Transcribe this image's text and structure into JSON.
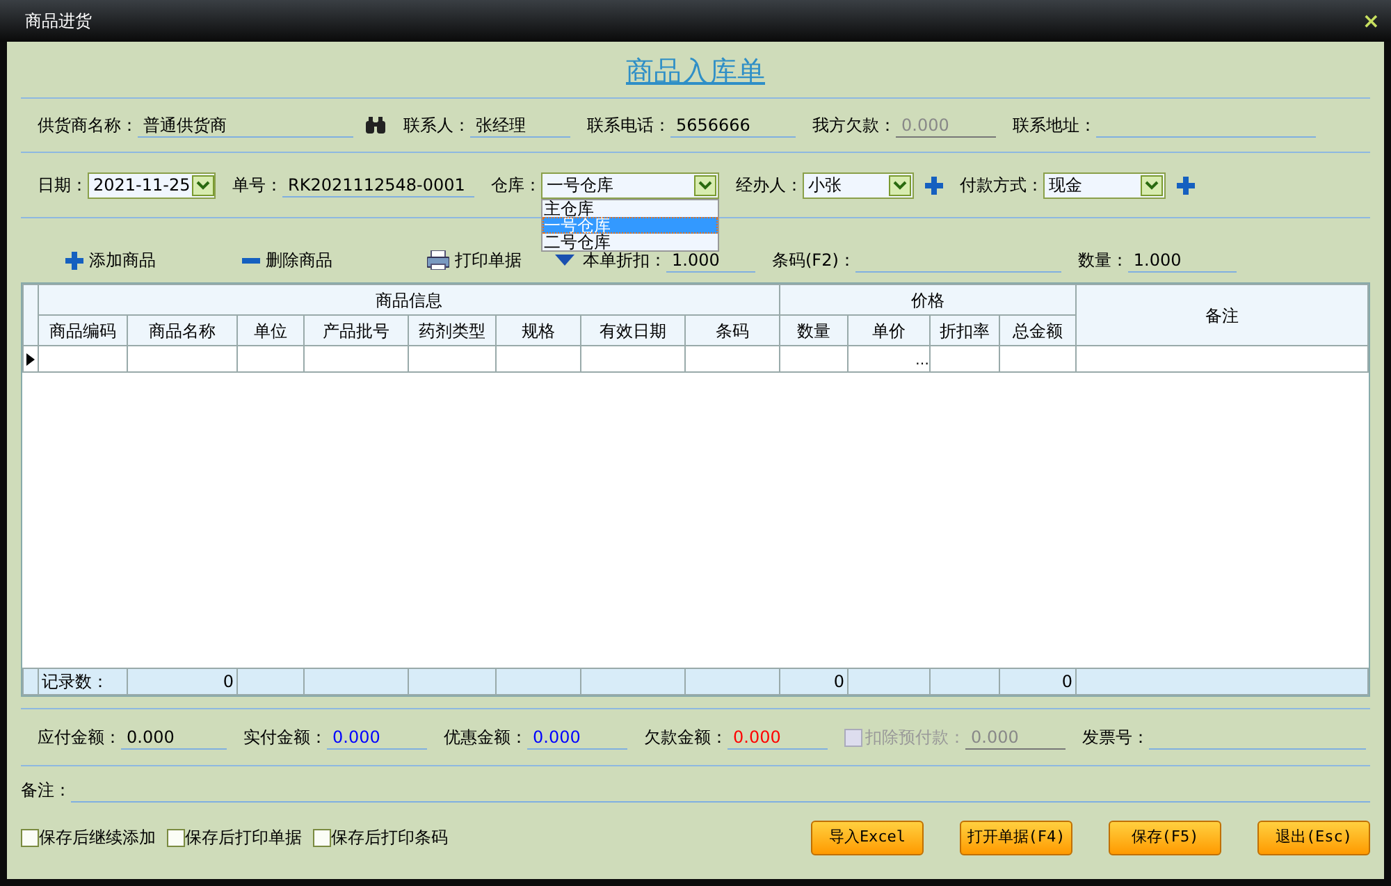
{
  "window": {
    "title": "商品进货",
    "close": "×"
  },
  "heading": "商品入库单",
  "supplier_row": [
    {
      "label": "供货商名称：",
      "value": "普通供货商",
      "kind": "lookup"
    },
    {
      "label": "联系人：",
      "value": "张经理",
      "kind": "text"
    },
    {
      "label": "联系电话：",
      "value": "5656666",
      "kind": "text"
    },
    {
      "label": "我方欠款：",
      "value": "0.000",
      "kind": "text",
      "disabled": true
    },
    {
      "label": "联系地址：",
      "kind": "wide"
    }
  ],
  "order_row": [
    {
      "label": "日期：",
      "value": "2021-11-25",
      "kind": "select"
    },
    {
      "label": "单号：",
      "value": "RK2021112548-0001",
      "kind": "text"
    },
    {
      "label": "仓库：",
      "value": "一号仓库",
      "kind": "select",
      "expanded": true,
      "options": [
        {
          "label": "主仓库",
          "selected": false
        },
        {
          "label": "一号仓库",
          "selected": true
        },
        {
          "label": "二号仓库",
          "selected": false
        }
      ]
    },
    {
      "label": "经办人：",
      "value": "小张",
      "kind": "select",
      "add": true
    },
    {
      "label": "付款方式：",
      "value": "现金",
      "kind": "select",
      "add": true
    }
  ],
  "toolbar": [
    {
      "label": "添加商品",
      "kind": "plus"
    },
    {
      "label": "删除商品",
      "kind": "minus"
    },
    {
      "label": "打印单据",
      "kind": "print"
    }
  ],
  "toolbar_fields": [
    {
      "label": "本单折扣：",
      "value": "1.000",
      "kind": "discount"
    },
    {
      "label": "条码(F2)：",
      "kind": "wide"
    },
    {
      "label": "数量：",
      "value": "1.000",
      "kind": "text"
    }
  ],
  "table": {
    "groups": [
      {
        "label": "商品信息",
        "columns": [
          "商品编码",
          "商品名称",
          "单位",
          "产品批号",
          "药剂类型",
          "规格",
          "有效日期",
          "条码"
        ]
      },
      {
        "label": "价格",
        "columns": [
          "数量",
          "单价",
          "折扣率",
          "总金额"
        ]
      }
    ],
    "remark_column": "备注",
    "rows": [
      {
        "selected": true,
        "cells": [
          null,
          null,
          null,
          null,
          null,
          null,
          null,
          null,
          null,
          "…",
          null,
          null
        ]
      }
    ],
    "footer": {
      "label": "记录数：",
      "count": "0",
      "quantity_total": "0",
      "amount_total": "0"
    }
  },
  "totals": [
    {
      "label": "应付金额：",
      "value": "0.000",
      "color": "#000000",
      "kind": "field"
    },
    {
      "label": "实付金额：",
      "value": "0.000",
      "color": "#0000ff",
      "kind": "field"
    },
    {
      "label": "优惠金额：",
      "value": "0.000",
      "color": "#0000ff",
      "kind": "field"
    },
    {
      "label": "欠款金额：",
      "value": "0.000",
      "color": "#ff0000",
      "kind": "field"
    },
    {
      "label": "扣除预付款：",
      "value": "0.000",
      "kind": "checkbox",
      "checked": false,
      "disabled": true
    },
    {
      "label": "发票号：",
      "kind": "field"
    }
  ],
  "remarks": {
    "label": "备注："
  },
  "options": [
    {
      "label": "保存后继续添加",
      "checked": false
    },
    {
      "label": "保存后打印单据",
      "checked": false
    },
    {
      "label": "保存后打印条码",
      "checked": false
    }
  ],
  "buttons": [
    "导入Excel",
    "打开单据(F4)",
    "保存(F5)",
    "退出(Esc)"
  ]
}
